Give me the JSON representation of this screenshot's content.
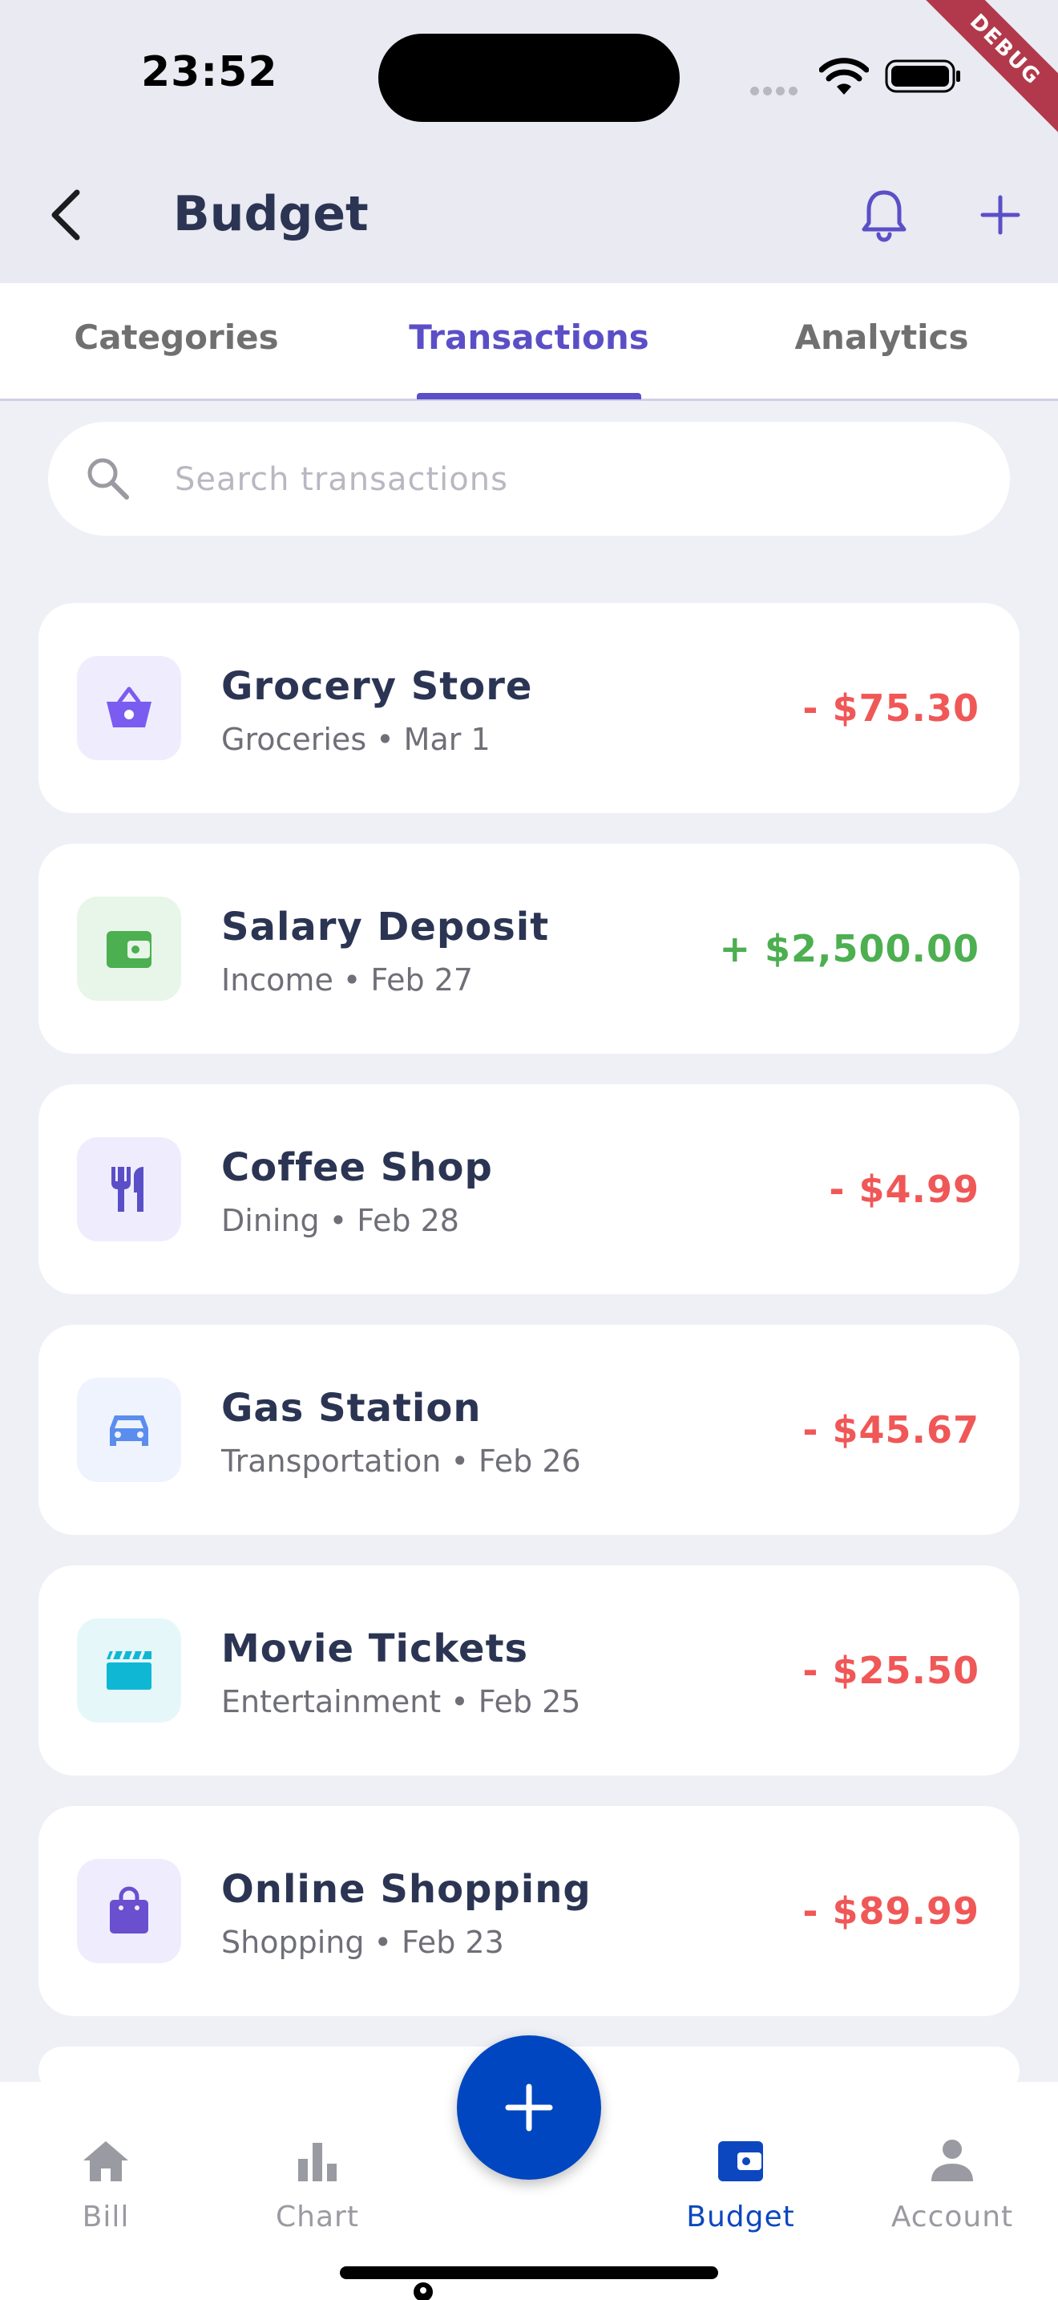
{
  "status_bar": {
    "time": "23:52",
    "debug_label": "DEBUG"
  },
  "app_bar": {
    "title": "Budget",
    "back_icon": "chevron-left-icon",
    "notification_icon": "bell-icon",
    "add_icon": "plus-icon",
    "accent_color": "#5b4fc7"
  },
  "tabs": [
    {
      "label": "Categories",
      "active": false
    },
    {
      "label": "Transactions",
      "active": true
    },
    {
      "label": "Analytics",
      "active": false
    }
  ],
  "search": {
    "placeholder": "Search transactions",
    "value": ""
  },
  "transactions": [
    {
      "name": "Grocery Store",
      "subtitle": "Groceries • Mar 1",
      "amount": "- $75.30",
      "type": "expense",
      "icon": "basket-icon",
      "icon_color": "#7b5cf0",
      "icon_bg": "#efedfd"
    },
    {
      "name": "Salary Deposit",
      "subtitle": "Income • Feb 27",
      "amount": "+ $2,500.00",
      "type": "income",
      "icon": "wallet-icon",
      "icon_color": "#4caf50",
      "icon_bg": "#e8f5e9"
    },
    {
      "name": "Coffee Shop",
      "subtitle": "Dining • Feb 28",
      "amount": "- $4.99",
      "type": "expense",
      "icon": "utensils-icon",
      "icon_color": "#5b4fc7",
      "icon_bg": "#efedfd"
    },
    {
      "name": "Gas Station",
      "subtitle": "Transportation • Feb 26",
      "amount": "- $45.67",
      "type": "expense",
      "icon": "car-icon",
      "icon_color": "#5b8def",
      "icon_bg": "#eef3fd"
    },
    {
      "name": "Movie Tickets",
      "subtitle": "Entertainment • Feb 25",
      "amount": "- $25.50",
      "type": "expense",
      "icon": "clapperboard-icon",
      "icon_color": "#10b7d4",
      "icon_bg": "#e6f7fa"
    },
    {
      "name": "Online Shopping",
      "subtitle": "Shopping • Feb 23",
      "amount": "- $89.99",
      "type": "expense",
      "icon": "shopping-bag-icon",
      "icon_color": "#6a4fcf",
      "icon_bg": "#efedfd"
    }
  ],
  "colors": {
    "expense": "#f05757",
    "income": "#4caf50",
    "nav_active": "#0d47c0",
    "fab": "#0046c0"
  },
  "bottom_nav": [
    {
      "label": "Bill",
      "icon": "home-icon",
      "active": false
    },
    {
      "label": "Chart",
      "icon": "bar-chart-icon",
      "active": false
    },
    {
      "label": "Budget",
      "icon": "wallet-icon",
      "active": true
    },
    {
      "label": "Account",
      "icon": "person-icon",
      "active": false
    }
  ],
  "fab": {
    "icon": "plus-icon"
  }
}
